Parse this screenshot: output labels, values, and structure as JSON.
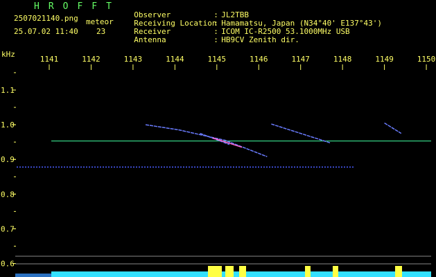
{
  "header": {
    "brand": "HROFFT",
    "filename": "2507021140.png",
    "mode_label": "meteor",
    "datetime": "25.07.02 11:40",
    "count": "23",
    "fields": [
      {
        "key": "Observer",
        "value": "JL2TBB"
      },
      {
        "key": "Receiving Location",
        "value": "Hamamatsu, Japan (N34°40' E137°43')"
      },
      {
        "key": "Receiver",
        "value": "ICOM IC-R2500 53.1000MHz USB"
      },
      {
        "key": "Antenna",
        "value": "HB9CV Zenith dir."
      }
    ]
  },
  "colors": {
    "text_yellow": "#ffff66",
    "text_green": "#66ff66",
    "reference_line": "#40ffa0",
    "baseline_band": "#33e0ff",
    "echo_band": "#ffff44",
    "trace_blue": "#6a7cff"
  },
  "chart_data": {
    "type": "spectrogram",
    "y_unit": "kHz",
    "x_ticks": [
      "1141",
      "1142",
      "1143",
      "1144",
      "1145",
      "1146",
      "1147",
      "1148",
      "1149",
      "1150"
    ],
    "y_ticks": [
      "1.1",
      "1.0",
      "0.9",
      "0.8",
      "0.7",
      "0.6"
    ],
    "x_range": [
      1140.6,
      1150.3
    ],
    "y_range": [
      0.58,
      1.2
    ],
    "reference_line_khz": 0.953,
    "carrier_khz": 0.878,
    "meteor_traces": [
      {
        "x": [
          1143.3,
          1144.1,
          1145.2,
          1146.2
        ],
        "y": [
          1.0,
          0.985,
          0.955,
          0.908
        ]
      },
      {
        "x": [
          1144.6,
          1145.3
        ],
        "y": [
          0.975,
          0.943
        ]
      },
      {
        "x": [
          1146.3,
          1147.7
        ],
        "y": [
          1.002,
          0.948
        ]
      },
      {
        "x": [
          1149.0,
          1149.4
        ],
        "y": [
          1.005,
          0.975
        ]
      }
    ]
  }
}
